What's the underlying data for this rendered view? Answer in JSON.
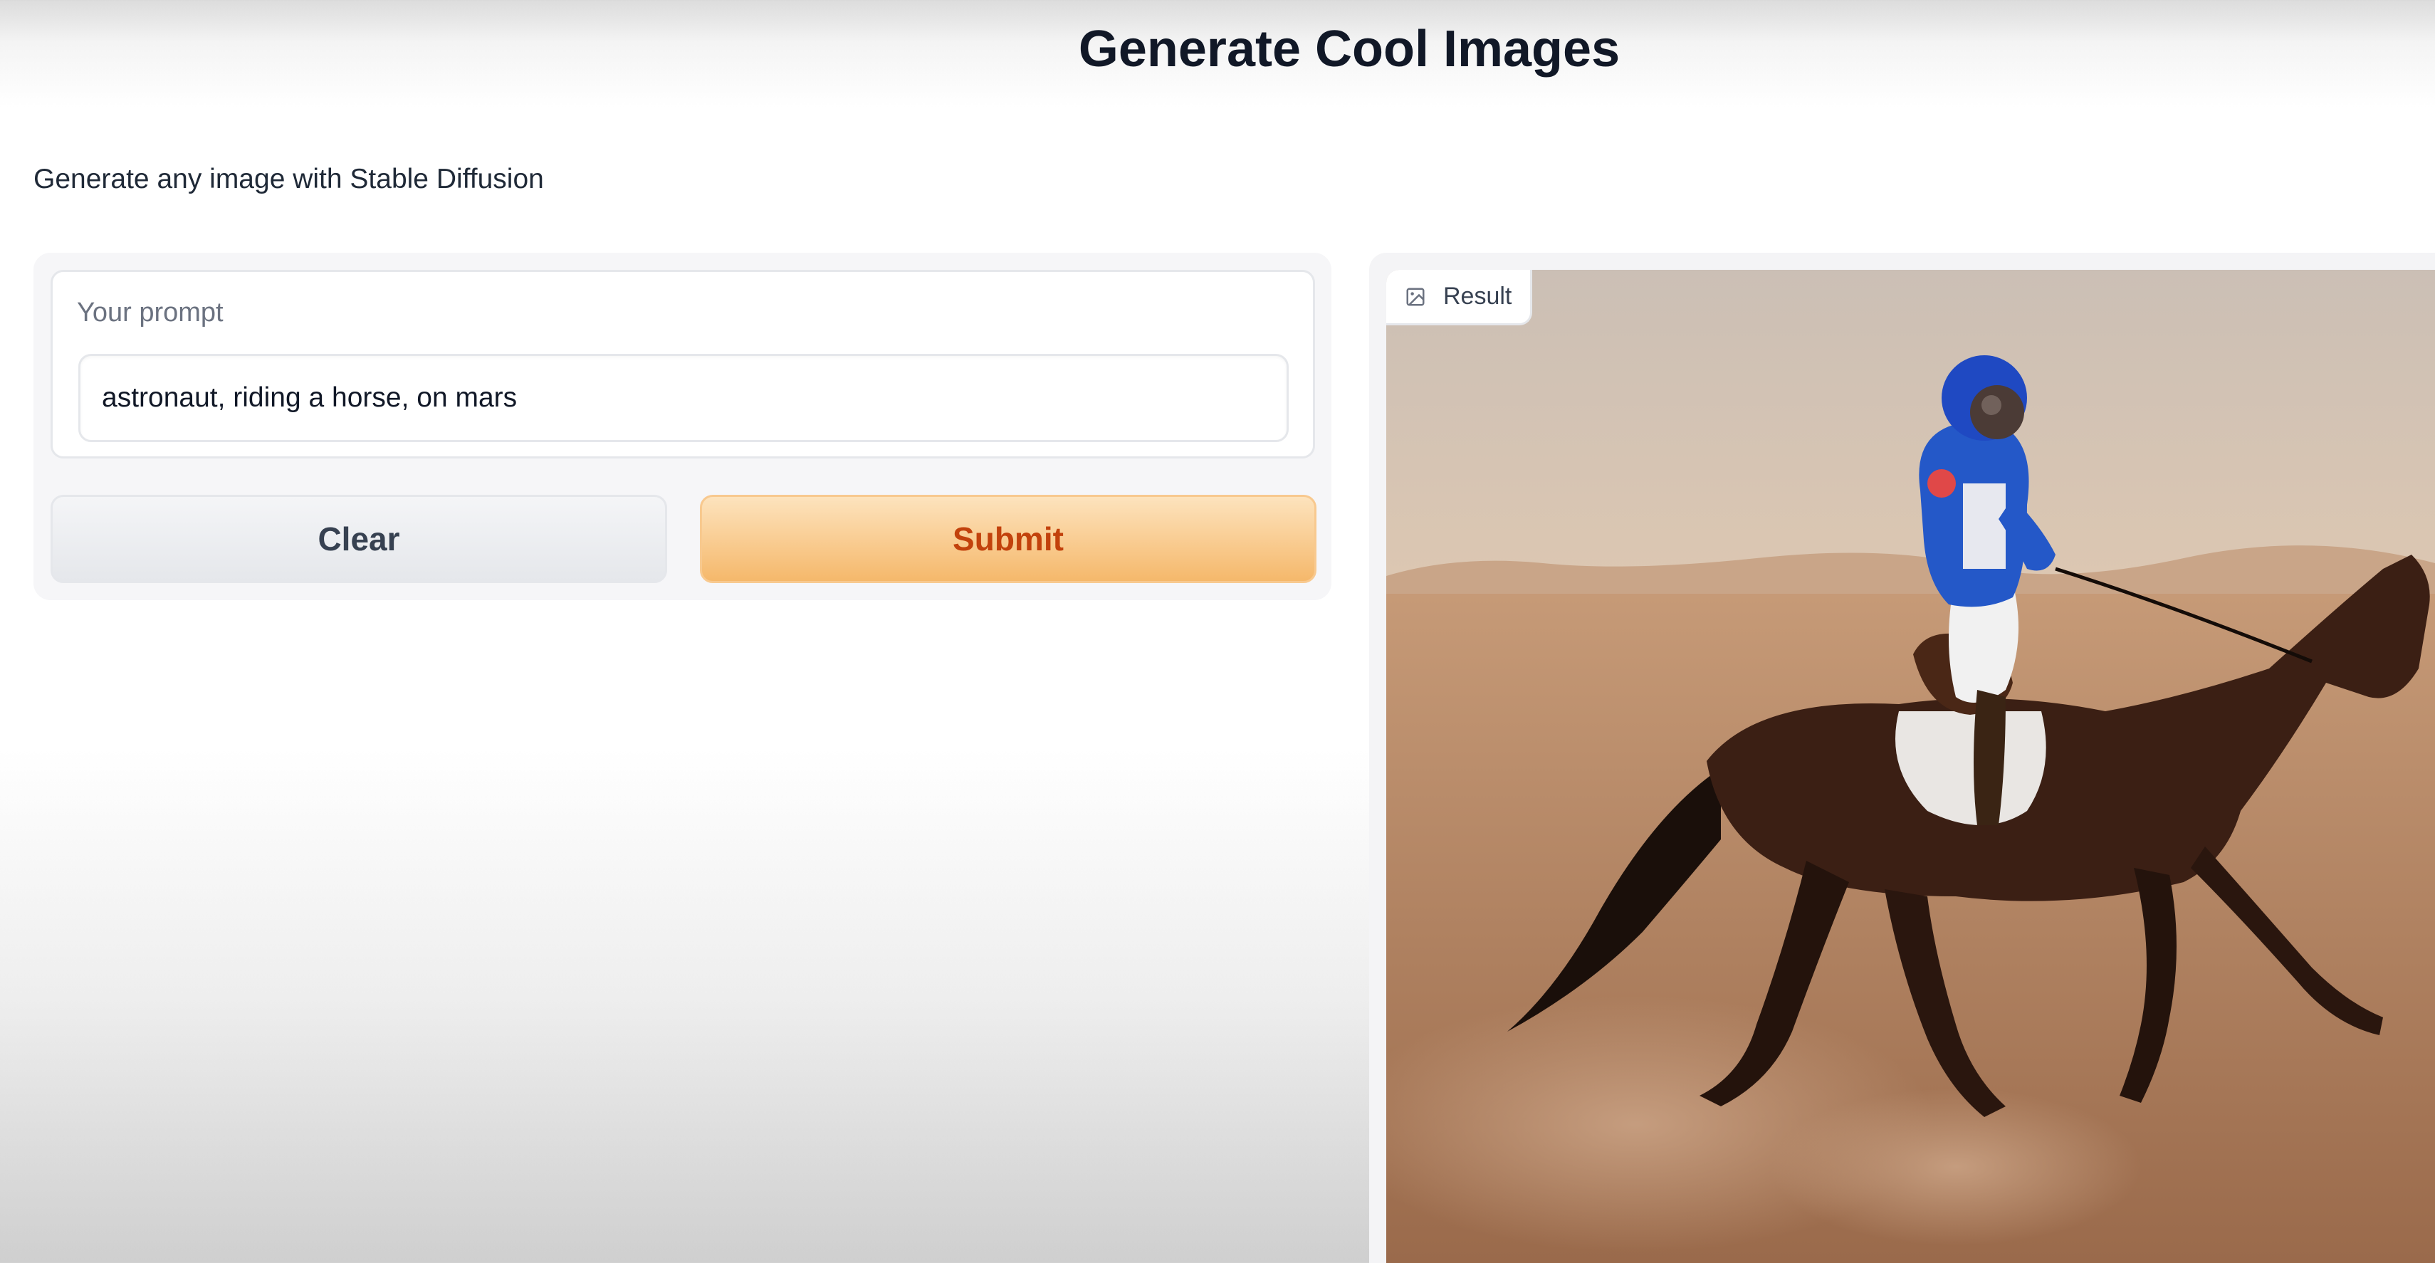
{
  "header": {
    "title": "Generate Cool Images"
  },
  "description": "Generate any image with Stable Diffusion",
  "input_panel": {
    "prompt_label": "Your prompt",
    "prompt_value": "astronaut, riding a horse, on mars"
  },
  "buttons": {
    "clear_label": "Clear",
    "submit_label": "Submit"
  },
  "output_panel": {
    "result_label": "Result",
    "result_icon": "image-icon"
  },
  "colors": {
    "submit_text": "#c2410c",
    "submit_bg": "#f5b86b",
    "clear_bg": "#e5e7eb"
  }
}
